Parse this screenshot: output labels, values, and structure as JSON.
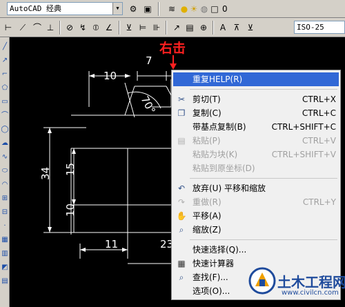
{
  "toolbar1": {
    "workspace_value": "AutoCAD 经典",
    "layer_value": "0"
  },
  "toolbar2": {
    "dimstyle_value": "ISO-25"
  },
  "drawing": {
    "annotation": "右击",
    "annotation_color": "#ff2020",
    "dims": {
      "d10_top": "10",
      "d7": "7",
      "angle": "70°",
      "d34": "34",
      "d15": "15",
      "d10_left": "10",
      "d11": "11",
      "d23": "23"
    }
  },
  "context_menu": {
    "highlight_color": "#3168d6",
    "items": [
      {
        "icon": "",
        "label": "重复HELP(R)",
        "shortcut": "",
        "disabled": false,
        "highlighted": true
      },
      {
        "icon": "scissors-icon",
        "label": "剪切(T)",
        "shortcut": "CTRL+X",
        "disabled": false
      },
      {
        "icon": "copy-icon",
        "label": "复制(C)",
        "shortcut": "CTRL+C",
        "disabled": false
      },
      {
        "icon": "",
        "label": "带基点复制(B)",
        "shortcut": "CTRL+SHIFT+C",
        "disabled": false
      },
      {
        "icon": "paste-icon",
        "label": "粘贴(P)",
        "shortcut": "CTRL+V",
        "disabled": true
      },
      {
        "icon": "",
        "label": "粘贴为块(K)",
        "shortcut": "CTRL+SHIFT+V",
        "disabled": true
      },
      {
        "icon": "",
        "label": "粘贴到原坐标(D)",
        "shortcut": "",
        "disabled": true
      },
      {
        "icon": "undo-icon",
        "label": "放弃(U) 平移和缩放",
        "shortcut": "",
        "disabled": false
      },
      {
        "icon": "redo-icon",
        "label": "重做(R)",
        "shortcut": "CTRL+Y",
        "disabled": true
      },
      {
        "icon": "pan-icon",
        "label": "平移(A)",
        "shortcut": "",
        "disabled": false
      },
      {
        "icon": "zoom-icon",
        "label": "缩放(Z)",
        "shortcut": "",
        "disabled": false
      },
      {
        "icon": "",
        "label": "快速选择(Q)...",
        "shortcut": "",
        "disabled": false
      },
      {
        "icon": "calculator-icon",
        "label": "快速计算器",
        "shortcut": "",
        "disabled": false
      },
      {
        "icon": "find-icon",
        "label": "查找(F)...",
        "shortcut": "",
        "disabled": false
      },
      {
        "icon": "",
        "label": "选项(O)...",
        "shortcut": "",
        "disabled": false
      }
    ]
  },
  "watermark": {
    "title": "土木工程网",
    "url": "www.civilcn.com"
  }
}
